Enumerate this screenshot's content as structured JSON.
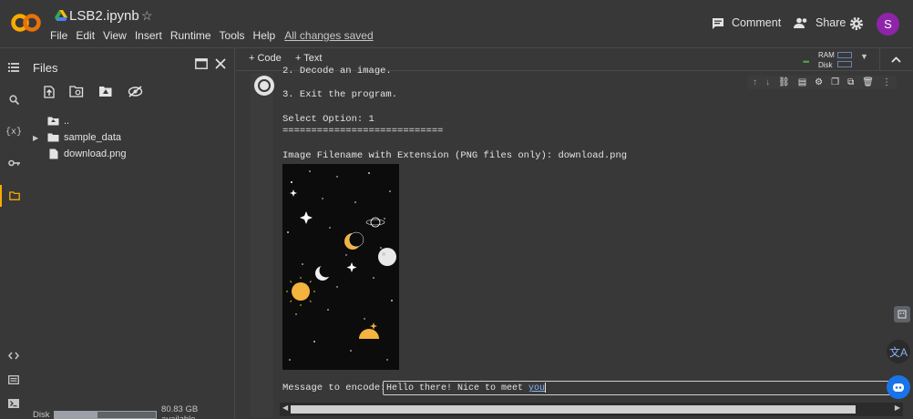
{
  "header": {
    "notebook_title": "LSB2.ipynb",
    "menu": [
      "File",
      "Edit",
      "View",
      "Insert",
      "Runtime",
      "Tools",
      "Help"
    ],
    "saved_status": "All changes saved",
    "comment_label": "Comment",
    "share_label": "Share",
    "avatar_letter": "S",
    "avatar_color": "#8e24aa"
  },
  "files": {
    "title": "Files",
    "tree": [
      {
        "label": "..",
        "type": "parent-folder"
      },
      {
        "label": "sample_data",
        "type": "folder"
      },
      {
        "label": "download.png",
        "type": "file"
      }
    ],
    "disk_label": "Disk",
    "disk_available": "80.83 GB available"
  },
  "toolbar": {
    "code_label": "Code",
    "text_label": "Text",
    "ram_label": "RAM",
    "disk_label": "Disk"
  },
  "cell": {
    "output_lines": [
      "2. Decode an image.",
      "3. Exit the program.",
      "Select Option: 1",
      "============================",
      "Image Filename with Extension (PNG files only): download.png"
    ],
    "encode_label": "Message to encode:",
    "input_text": "Hello there! Nice to meet ",
    "input_misspelled": "you"
  },
  "colors": {
    "accent_orange": "#f9ab00",
    "ram_green": "#4caf50"
  }
}
